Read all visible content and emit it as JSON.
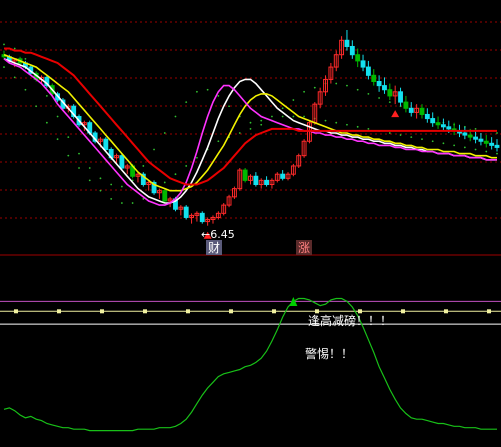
{
  "colors": {
    "background": "#000000",
    "up_candle": "#ff2a2a",
    "down_candle": "#14e0ee",
    "down_candle_dark": "#00b800",
    "grid": "#9a0000",
    "panel_divider": "#a00000",
    "ma_white": "#ffffff",
    "ma_yellow": "#f2f200",
    "ma_magenta": "#ff33ff",
    "ma_red": "#e80000",
    "band_dots": "#30c030",
    "osc_line": "#18c018",
    "level_magenta": "#c050c0",
    "level_yellow": "#f0f0a0",
    "level_white": "#ffffff",
    "text_note": "#ffffff",
    "marker_red": "#ff2020",
    "marker_green": "#00d000",
    "label_bg": "#5a5a7a"
  },
  "price_annotation": "←6.45",
  "tags": {
    "cai": "财",
    "zhang": "涨"
  },
  "notes": {
    "high_warning": "逢高减磅！！！",
    "alert": "警惕！！"
  },
  "chart_data": {
    "type": "candlestick",
    "ylim": [
      0,
      100
    ],
    "grid": true,
    "candles": [
      [
        88,
        90,
        86,
        87
      ],
      [
        87,
        88,
        84,
        85
      ],
      [
        85,
        86,
        82,
        86
      ],
      [
        86,
        87,
        83,
        84
      ],
      [
        84,
        85,
        81,
        82
      ],
      [
        82,
        83,
        78,
        79
      ],
      [
        79,
        80,
        75,
        76
      ],
      [
        76,
        78,
        74,
        77
      ],
      [
        77,
        78,
        72,
        73
      ],
      [
        73,
        74,
        68,
        69
      ],
      [
        69,
        70,
        65,
        66
      ],
      [
        66,
        67,
        61,
        62
      ],
      [
        62,
        64,
        60,
        63
      ],
      [
        63,
        64,
        57,
        58
      ],
      [
        58,
        59,
        53,
        54
      ],
      [
        54,
        56,
        51,
        55
      ],
      [
        55,
        56,
        49,
        50
      ],
      [
        50,
        51,
        45,
        46
      ],
      [
        46,
        48,
        43,
        47
      ],
      [
        47,
        48,
        41,
        42
      ],
      [
        42,
        43,
        37,
        38
      ],
      [
        38,
        40,
        35,
        39
      ],
      [
        39,
        40,
        32,
        33
      ],
      [
        33,
        35,
        30,
        34
      ],
      [
        34,
        35,
        28,
        29
      ],
      [
        29,
        31,
        26,
        30
      ],
      [
        30,
        31,
        24,
        25
      ],
      [
        25,
        27,
        22,
        26
      ],
      [
        26,
        27,
        20,
        21
      ],
      [
        21,
        23,
        18,
        22
      ],
      [
        22,
        23,
        16,
        17
      ],
      [
        17,
        19,
        14,
        18
      ],
      [
        18,
        19,
        12,
        13
      ],
      [
        13,
        15,
        10,
        14
      ],
      [
        14,
        15,
        8,
        9
      ],
      [
        9,
        11,
        6,
        10
      ],
      [
        10,
        12,
        7,
        11
      ],
      [
        11,
        12,
        6,
        7
      ],
      [
        7,
        9,
        5,
        8
      ],
      [
        8,
        10,
        6,
        9
      ],
      [
        9,
        12,
        8,
        11
      ],
      [
        11,
        16,
        10,
        15
      ],
      [
        15,
        20,
        14,
        19
      ],
      [
        19,
        24,
        18,
        23
      ],
      [
        23,
        33,
        22,
        32
      ],
      [
        32,
        33,
        26,
        27
      ],
      [
        27,
        30,
        25,
        29
      ],
      [
        29,
        31,
        24,
        25
      ],
      [
        25,
        28,
        23,
        27
      ],
      [
        27,
        29,
        24,
        25
      ],
      [
        25,
        28,
        23,
        27
      ],
      [
        27,
        31,
        26,
        30
      ],
      [
        30,
        32,
        27,
        28
      ],
      [
        28,
        31,
        27,
        30
      ],
      [
        30,
        35,
        29,
        34
      ],
      [
        34,
        40,
        33,
        39
      ],
      [
        39,
        47,
        38,
        46
      ],
      [
        46,
        56,
        45,
        55
      ],
      [
        55,
        65,
        54,
        64
      ],
      [
        64,
        72,
        62,
        70
      ],
      [
        70,
        78,
        68,
        76
      ],
      [
        76,
        84,
        74,
        82
      ],
      [
        82,
        90,
        80,
        88
      ],
      [
        88,
        97,
        86,
        95
      ],
      [
        95,
        100,
        90,
        92
      ],
      [
        92,
        95,
        86,
        88
      ],
      [
        88,
        91,
        82,
        85
      ],
      [
        85,
        88,
        80,
        82
      ],
      [
        82,
        85,
        76,
        78
      ],
      [
        78,
        81,
        73,
        75
      ],
      [
        75,
        78,
        70,
        73
      ],
      [
        73,
        77,
        69,
        71
      ],
      [
        71,
        74,
        66,
        68
      ],
      [
        68,
        73,
        64,
        70
      ],
      [
        70,
        72,
        63,
        65
      ],
      [
        65,
        68,
        60,
        62
      ],
      [
        62,
        65,
        58,
        60
      ],
      [
        60,
        64,
        57,
        62
      ],
      [
        62,
        64,
        57,
        59
      ],
      [
        59,
        62,
        55,
        57
      ],
      [
        57,
        60,
        53,
        55
      ],
      [
        55,
        58,
        52,
        54
      ],
      [
        54,
        57,
        51,
        53
      ],
      [
        53,
        56,
        50,
        52
      ],
      [
        52,
        55,
        49,
        51
      ],
      [
        51,
        54,
        48,
        50
      ],
      [
        50,
        53,
        47,
        49
      ],
      [
        49,
        52,
        46,
        48
      ],
      [
        48,
        51,
        45,
        47
      ],
      [
        47,
        50,
        44,
        46
      ],
      [
        46,
        49,
        43,
        45
      ],
      [
        45,
        48,
        42,
        44
      ],
      [
        44,
        47,
        41,
        43
      ]
    ],
    "moving_averages": [
      {
        "color_key": "ma_white",
        "values": [
          86,
          85,
          84,
          83,
          82,
          80,
          78,
          76,
          74,
          71,
          68,
          65,
          62,
          59,
          56,
          53,
          50,
          47,
          44,
          41,
          38,
          35,
          32,
          29,
          26,
          23,
          21,
          19,
          18,
          17,
          16,
          16,
          17,
          19,
          22,
          26,
          31,
          37,
          43,
          50,
          57,
          63,
          68,
          72,
          75,
          76,
          76,
          74,
          71,
          68,
          65,
          62,
          60,
          58,
          56,
          55,
          54,
          53,
          52,
          51,
          51,
          50,
          50,
          49,
          49,
          48,
          48,
          47,
          47,
          46,
          46,
          45,
          45,
          44,
          44,
          43,
          43,
          42,
          42,
          41,
          41,
          40,
          40,
          40,
          39,
          39,
          39,
          38,
          38,
          38,
          37,
          37,
          37
        ]
      },
      {
        "color_key": "ma_yellow",
        "values": [
          88,
          87,
          86,
          85,
          84,
          83,
          82,
          80,
          78,
          76,
          74,
          72,
          70,
          67,
          64,
          61,
          58,
          55,
          52,
          49,
          46,
          43,
          40,
          37,
          34,
          31,
          29,
          27,
          25,
          24,
          23,
          22,
          22,
          22,
          23,
          24,
          26,
          29,
          32,
          36,
          40,
          44,
          49,
          54,
          59,
          63,
          66,
          68,
          69,
          69,
          68,
          66,
          64,
          62,
          60,
          58,
          57,
          56,
          55,
          54,
          53,
          52,
          51,
          50,
          50,
          49,
          49,
          48,
          48,
          47,
          47,
          46,
          46,
          45,
          45,
          44,
          44,
          43,
          43,
          42,
          42,
          42,
          41,
          41,
          41,
          40,
          40,
          40,
          39,
          39,
          39,
          38,
          38
        ]
      },
      {
        "color_key": "ma_magenta",
        "values": [
          86,
          84,
          83,
          82,
          80,
          78,
          76,
          74,
          71,
          68,
          64,
          61,
          58,
          55,
          52,
          49,
          46,
          43,
          40,
          37,
          34,
          31,
          28,
          25,
          23,
          21,
          19,
          17,
          16,
          15,
          15,
          16,
          18,
          21,
          26,
          33,
          41,
          50,
          58,
          65,
          70,
          73,
          73,
          71,
          68,
          65,
          62,
          60,
          58,
          57,
          56,
          55,
          54,
          53,
          52,
          52,
          51,
          51,
          50,
          50,
          49,
          49,
          48,
          48,
          47,
          47,
          46,
          46,
          45,
          45,
          44,
          44,
          44,
          43,
          43,
          42,
          42,
          42,
          41,
          41,
          41,
          40,
          40,
          40,
          39,
          39,
          39,
          38,
          38,
          38,
          37,
          37,
          37
        ]
      },
      {
        "color_key": "ma_red",
        "values": [
          91,
          91,
          90,
          90,
          89,
          89,
          88,
          87,
          86,
          85,
          84,
          82,
          80,
          78,
          75,
          72,
          69,
          66,
          63,
          60,
          57,
          54,
          51,
          48,
          45,
          42,
          39,
          36,
          34,
          32,
          30,
          28,
          27,
          26,
          25,
          25,
          25,
          26,
          27,
          29,
          31,
          33,
          36,
          39,
          42,
          45,
          47,
          49,
          50,
          51,
          52,
          52,
          52,
          52,
          52,
          51,
          51,
          51,
          51,
          51,
          51,
          51,
          51,
          51,
          51,
          51,
          51,
          51,
          51,
          51,
          51,
          51,
          51,
          51,
          51,
          51,
          51,
          51,
          51,
          51,
          51,
          51,
          51,
          51,
          51,
          51,
          51,
          51,
          51,
          51,
          51,
          51,
          51
        ]
      }
    ],
    "band": {
      "upper": [
        93,
        92,
        91,
        89,
        86,
        82,
        78,
        73,
        68,
        63,
        58,
        53,
        48,
        44,
        40,
        36,
        33,
        30,
        28,
        26,
        25,
        24,
        24,
        25,
        27,
        30,
        34,
        38,
        42,
        46,
        50,
        54,
        58,
        62,
        65,
        68,
        70,
        71,
        71,
        70,
        68,
        66,
        63,
        60,
        58,
        56,
        55,
        55,
        56,
        57,
        58,
        60,
        62,
        64,
        66,
        68,
        70,
        71,
        72,
        73,
        74,
        74,
        74,
        74,
        73,
        72,
        71,
        70,
        69,
        68,
        67,
        66,
        65,
        64,
        63,
        62,
        61,
        60,
        59,
        58,
        57,
        56,
        55,
        54,
        54,
        53,
        53,
        52,
        52,
        51,
        51,
        50,
        50
      ],
      "lower": [
        82,
        80,
        77,
        74,
        71,
        67,
        63,
        59,
        55,
        51,
        47,
        43,
        39,
        36,
        33,
        30,
        27,
        24,
        22,
        20,
        18,
        17,
        16,
        16,
        16,
        17,
        18,
        20,
        22,
        24,
        26,
        28,
        30,
        32,
        34,
        36,
        38,
        40,
        42,
        44,
        46,
        47,
        48,
        49,
        50,
        51,
        52,
        53,
        54,
        55,
        56,
        57,
        58,
        58,
        58,
        58,
        58,
        57,
        57,
        56,
        56,
        55,
        55,
        54,
        54,
        53,
        53,
        52,
        52,
        51,
        51,
        50,
        50,
        49,
        49,
        48,
        48,
        47,
        47,
        46,
        46,
        45,
        45,
        44,
        44,
        43,
        43,
        42,
        42,
        41,
        41,
        40,
        40
      ]
    },
    "markers": [
      {
        "index": 38,
        "kind": "triangle-up",
        "color_key": "marker_red"
      },
      {
        "index": 73,
        "kind": "triangle-up",
        "color_key": "marker_red"
      }
    ],
    "oscillator": {
      "ylim": [
        0,
        100
      ],
      "levels": [
        {
          "value": 92,
          "color_key": "level_magenta"
        },
        {
          "value": 85,
          "color_key": "level_yellow"
        },
        {
          "value": 76,
          "color_key": "level_white"
        }
      ],
      "values": [
        16,
        17,
        15,
        12,
        10,
        11,
        9,
        8,
        6,
        5,
        4,
        3,
        3,
        2,
        2,
        2,
        1,
        1,
        1,
        1,
        1,
        1,
        1,
        1,
        1,
        2,
        2,
        2,
        2,
        3,
        3,
        3,
        4,
        6,
        9,
        14,
        20,
        26,
        31,
        35,
        39,
        41,
        42,
        43,
        44,
        46,
        47,
        49,
        52,
        57,
        64,
        72,
        81,
        88,
        92,
        94,
        94,
        93,
        91,
        89,
        90,
        93,
        94,
        94,
        92,
        88,
        82,
        74,
        65,
        56,
        46,
        38,
        30,
        23,
        17,
        13,
        10,
        9,
        9,
        8,
        7,
        6,
        6,
        5,
        4,
        4,
        3,
        3,
        3,
        2,
        2,
        2,
        2
      ]
    }
  }
}
